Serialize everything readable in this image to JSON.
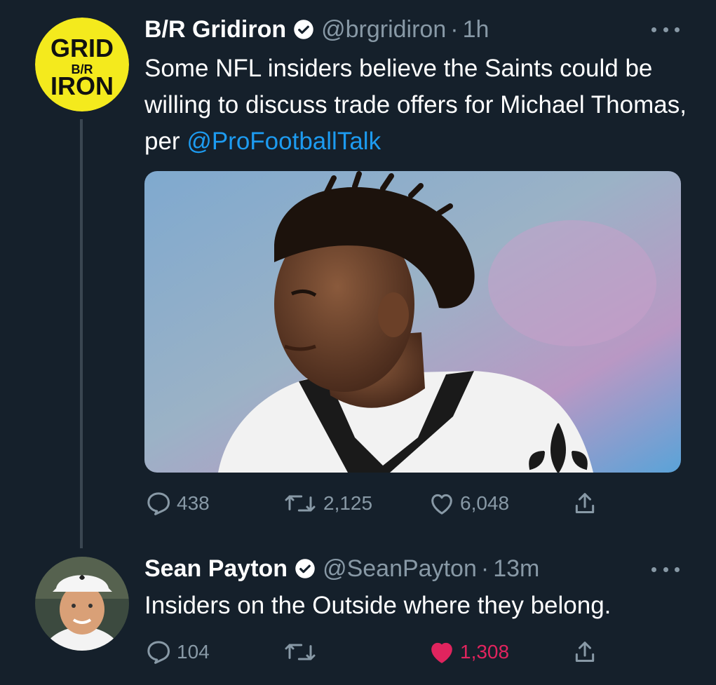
{
  "tweets": [
    {
      "avatar": {
        "kind": "logo",
        "lines": [
          "GRID",
          "B/R",
          "IRON"
        ]
      },
      "name": "B/R Gridiron",
      "handle": "@brgridiron",
      "time": "1h",
      "text_parts": [
        "Some NFL insiders believe the Saints could be willing to discuss trade offers for Michael Thomas, per "
      ],
      "mention": "@ProFootballTalk",
      "media_icon": "photo-player-portrait",
      "stats": {
        "replies": "438",
        "retweets": "2,125",
        "likes": "6,048"
      }
    },
    {
      "avatar": {
        "kind": "photo",
        "icon": "coach-portrait"
      },
      "name": "Sean Payton",
      "handle": "@SeanPayton",
      "time": "13m",
      "text": "Insiders on the Outside where they belong.",
      "stats": {
        "replies": "104",
        "likes": "1,308"
      },
      "liked": true
    }
  ],
  "separator": "·",
  "colors": {
    "background": "#15202b",
    "muted": "#8899a6",
    "link": "#1d9bf0",
    "like": "#e0245e",
    "logo_yellow": "#f4ea1d"
  }
}
